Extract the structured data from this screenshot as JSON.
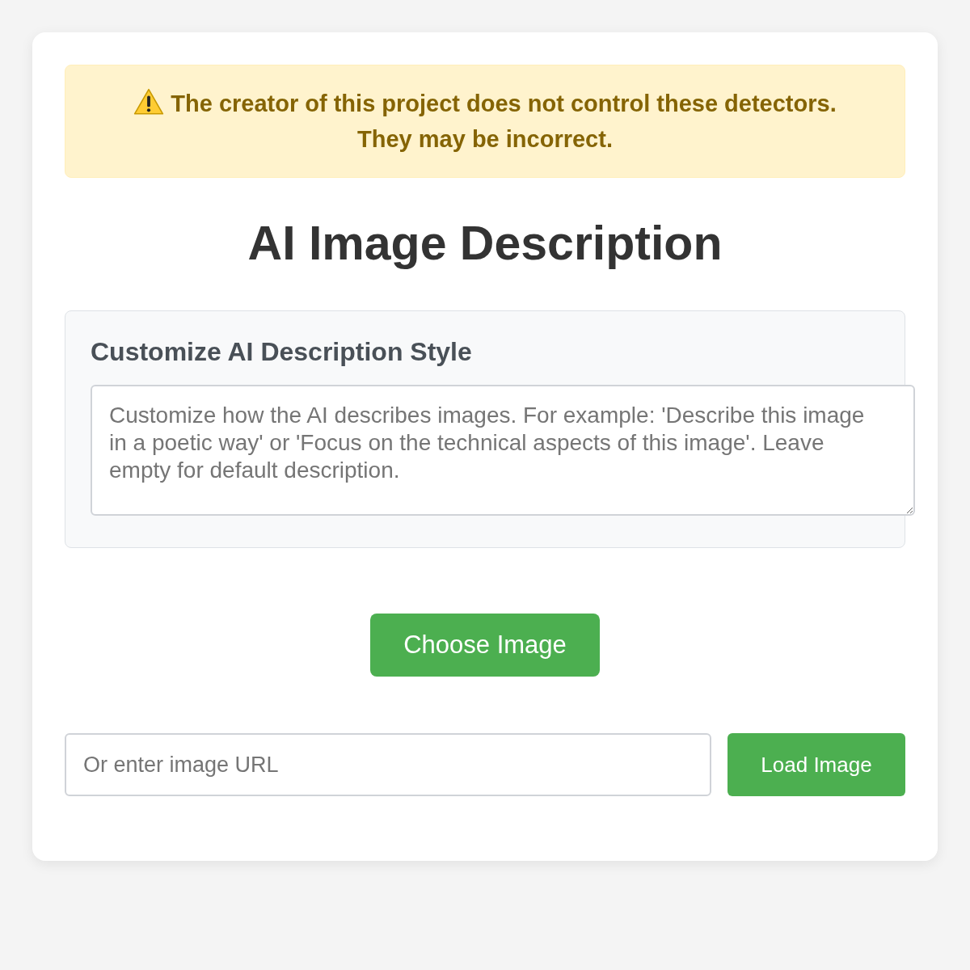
{
  "alert": {
    "text": "The creator of this project does not control these detectors. They may be incorrect."
  },
  "title": "AI Image Description",
  "style_panel": {
    "heading": "Customize AI Description Style",
    "textarea": {
      "placeholder": "Customize how the AI describes images. For example: 'Describe this image in a poetic way' or 'Focus on the technical aspects of this image'. Leave empty for default description."
    }
  },
  "choose_button": {
    "label": "Choose Image"
  },
  "url_row": {
    "input": {
      "placeholder": "Or enter image URL"
    },
    "button": {
      "label": "Load Image"
    }
  }
}
